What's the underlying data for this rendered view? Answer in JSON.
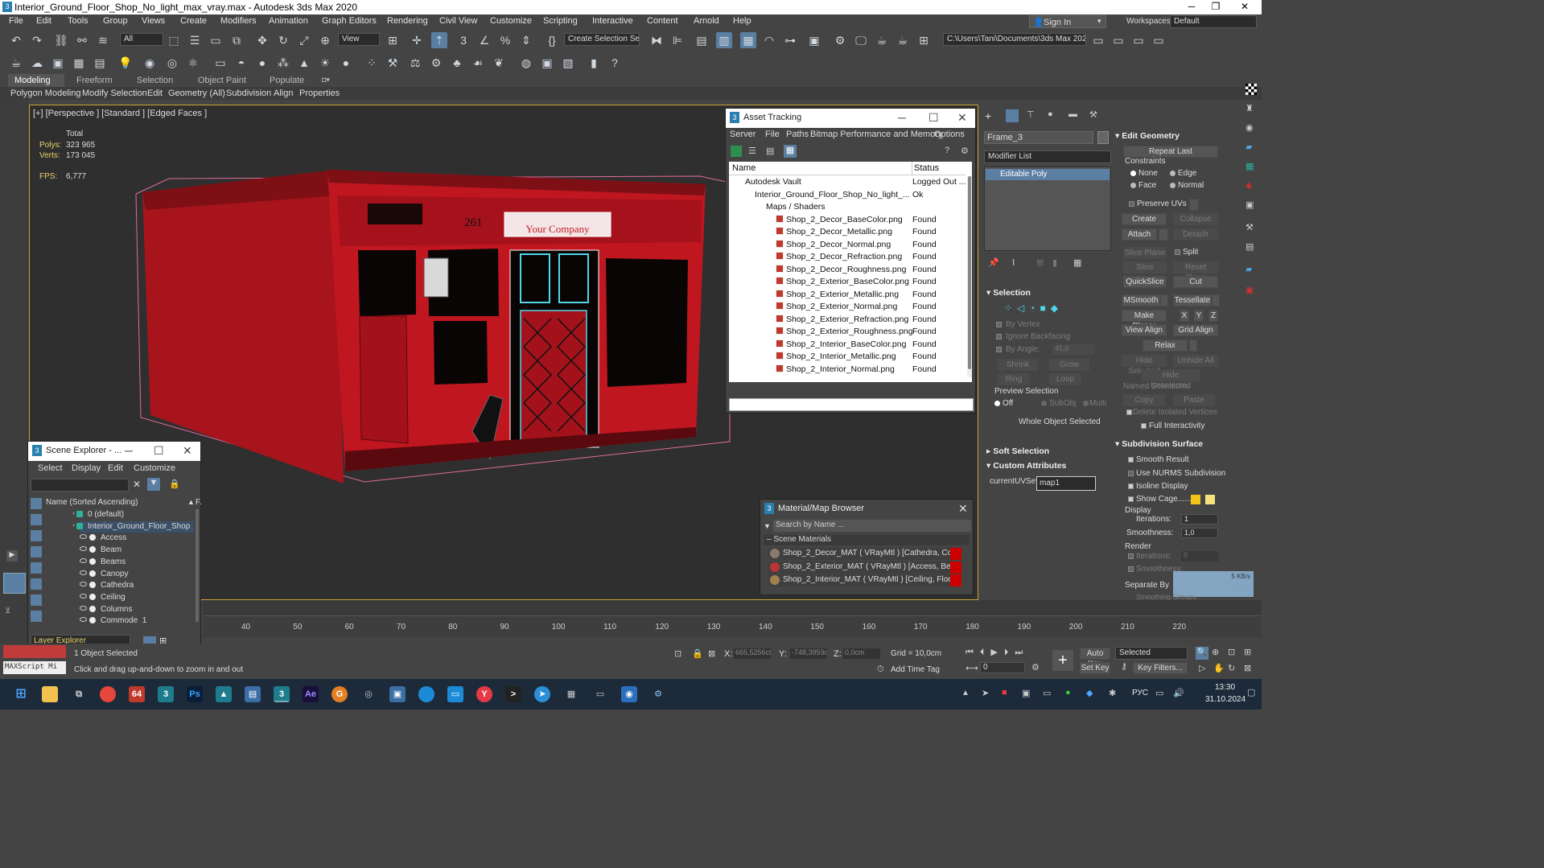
{
  "window": {
    "title": "Interior_Ground_Floor_Shop_No_light_max_vray.max - Autodesk 3ds Max 2020"
  },
  "menu": [
    "File",
    "Edit",
    "Tools",
    "Group",
    "Views",
    "Create",
    "Modifiers",
    "Animation",
    "Graph Editors",
    "Rendering",
    "Civil View",
    "Customize",
    "Scripting",
    "Interactive",
    "Content",
    "Arnold",
    "Help"
  ],
  "account": {
    "signin": "Sign In",
    "workspaces_label": "Workspaces:",
    "workspace": "Default"
  },
  "toolbar": {
    "filter": "All",
    "refcoord": "View",
    "selset": "Create Selection Se",
    "path": "C:\\Users\\Tani\\Documents\\3ds Max 2020"
  },
  "ribbon": {
    "tabs": [
      "Modeling",
      "Freeform",
      "Selection",
      "Object Paint",
      "Populate"
    ],
    "sub": [
      "Polygon Modeling",
      "Modify Selection",
      "Edit",
      "Geometry (All)",
      "Subdivision",
      "Align",
      "Properties"
    ]
  },
  "viewport": {
    "label": "[+] [Perspective ] [Standard ] [Edged Faces ]",
    "total": "Total",
    "polys_label": "Polys:",
    "polys": "323 965",
    "verts_label": "Verts:",
    "verts": "173 045",
    "fps_label": "FPS:",
    "fps": "6,777",
    "sign": "Your Company",
    "number": "261"
  },
  "asset_tracking": {
    "title": "Asset Tracking",
    "menu": [
      "Server",
      "File",
      "Paths",
      "Bitmap Performance and Memory",
      "Options"
    ],
    "col_name": "Name",
    "col_status": "Status",
    "rows": [
      {
        "name": "Autodesk Vault",
        "status": "Logged Out ..."
      },
      {
        "name": "Interior_Ground_Floor_Shop_No_light_...",
        "status": "Ok"
      },
      {
        "name": "Maps / Shaders",
        "status": ""
      },
      {
        "name": "Shop_2_Decor_BaseColor.png",
        "status": "Found"
      },
      {
        "name": "Shop_2_Decor_Metallic.png",
        "status": "Found"
      },
      {
        "name": "Shop_2_Decor_Normal.png",
        "status": "Found"
      },
      {
        "name": "Shop_2_Decor_Refraction.png",
        "status": "Found"
      },
      {
        "name": "Shop_2_Decor_Roughness.png",
        "status": "Found"
      },
      {
        "name": "Shop_2_Exterior_BaseColor.png",
        "status": "Found"
      },
      {
        "name": "Shop_2_Exterior_Metallic.png",
        "status": "Found"
      },
      {
        "name": "Shop_2_Exterior_Normal.png",
        "status": "Found"
      },
      {
        "name": "Shop_2_Exterior_Refraction.png",
        "status": "Found"
      },
      {
        "name": "Shop_2_Exterior_Roughness.png",
        "status": "Found"
      },
      {
        "name": "Shop_2_Interior_BaseColor.png",
        "status": "Found"
      },
      {
        "name": "Shop_2_Interior_Metallic.png",
        "status": "Found"
      },
      {
        "name": "Shop_2_Interior_Normal.png",
        "status": "Found"
      }
    ]
  },
  "scene_explorer": {
    "title": "Scene Explorer - ...",
    "menu": [
      "Select",
      "Display",
      "Edit",
      "Customize"
    ],
    "col": "Name (Sorted Ascending)",
    "col2": "F.",
    "rows": [
      "0 (default)",
      "Interior_Ground_Floor_Shop",
      "Access",
      "Beam",
      "Beams",
      "Canopy",
      "Cathedra",
      "Ceiling",
      "Columns",
      "Commode_1"
    ],
    "layer": "Layer Explorer"
  },
  "material_browser": {
    "title": "Material/Map Browser",
    "search": "Search by Name ...",
    "group": "Scene Materials",
    "items": [
      "Shop_2_Decor_MAT  ( VRayMtl ) [Cathedra, Com...",
      "Shop_2_Exterior_MAT  ( VRayMtl ) [Access, Beam,...",
      "Shop_2_Interior_MAT  ( VRayMtl ) [Ceiling, Floor,..."
    ]
  },
  "command_panel": {
    "object_name": "Frame_3",
    "modifier_list": "Modifier List",
    "stack": "Editable Poly",
    "selection": {
      "header": "Selection",
      "by_vertex": "By Vertex",
      "ignore_backfacing": "Ignore Backfacing",
      "by_angle": "By Angle:",
      "angle": "45,0",
      "shrink": "Shrink",
      "grow": "Grow",
      "ring": "Ring",
      "loop": "Loop",
      "preview": "Preview Selection",
      "off": "Off",
      "subobj": "SubObj",
      "multi": "Multi",
      "whole": "Whole Object Selected"
    },
    "soft_selection": "Soft Selection",
    "custom_attributes": "Custom Attributes",
    "uvset_label": "currentUVSet",
    "uvset": "map1",
    "edit_geometry": {
      "header": "Edit Geometry",
      "repeat_last": "Repeat Last",
      "constraints": "Constraints",
      "none": "None",
      "edge": "Edge",
      "face": "Face",
      "normal": "Normal",
      "preserve_uvs": "Preserve UVs",
      "create": "Create",
      "collapse": "Collapse",
      "attach": "Attach",
      "detach": "Detach",
      "slice_plane": "Slice Plane",
      "split": "Split",
      "slice": "Slice",
      "reset_plane": "Reset Plane",
      "quickslice": "QuickSlice",
      "cut": "Cut",
      "msmooth": "MSmooth",
      "tessellate": "Tessellate",
      "make_planar": "Make Planar",
      "x": "X",
      "y": "Y",
      "z": "Z",
      "view_align": "View Align",
      "grid_align": "Grid Align",
      "relax": "Relax",
      "hide_selected": "Hide Selected",
      "unhide_all": "Unhide All",
      "hide_unselected": "Hide Unselected",
      "named_selections": "Named Selections:",
      "copy": "Copy",
      "paste": "Paste",
      "delete_isolated": "Delete Isolated Vertices",
      "full_interactivity": "Full Interactivity"
    },
    "subdivision": {
      "header": "Subdivision Surface",
      "smooth_result": "Smooth Result",
      "use_nurms": "Use NURMS Subdivision",
      "isoline": "Isoline Display",
      "show_cage": "Show Cage......",
      "display": "Display",
      "iterations_label": "Iterations:",
      "iterations": "1",
      "smoothness_label": "Smoothness:",
      "smoothness": "1,0",
      "render": "Render",
      "r_iterations": "0",
      "r_smoothness": "1,0",
      "separate_by": "Separate By",
      "smoothing_groups": "Smoothing Groups"
    }
  },
  "timeline": {
    "ticks": [
      "40",
      "50",
      "60",
      "70",
      "80",
      "90",
      "100",
      "110",
      "120",
      "130",
      "140",
      "150",
      "160",
      "170",
      "180",
      "190",
      "200",
      "210",
      "220"
    ]
  },
  "status": {
    "selected": "1 Object Selected",
    "hint": "Click and drag up-and-down to zoom in and out",
    "x_label": "X:",
    "x": "665,5256cl",
    "y_label": "Y:",
    "y": "-748,3959c",
    "z_label": "Z:",
    "z": "0,0cm",
    "grid": "Grid = 10,0cm",
    "add_time_tag": "Add Time Tag",
    "frame": "0",
    "auto_key": "Auto Key",
    "set_key": "Set Key",
    "key_mode": "Selected",
    "key_filters": "Key Filters...",
    "maxscript": "MAXScript Mi",
    "net": "5 KB/s"
  },
  "taskbar": {
    "lang": "РУС",
    "time": "13:30",
    "date": "31.10.2024"
  }
}
